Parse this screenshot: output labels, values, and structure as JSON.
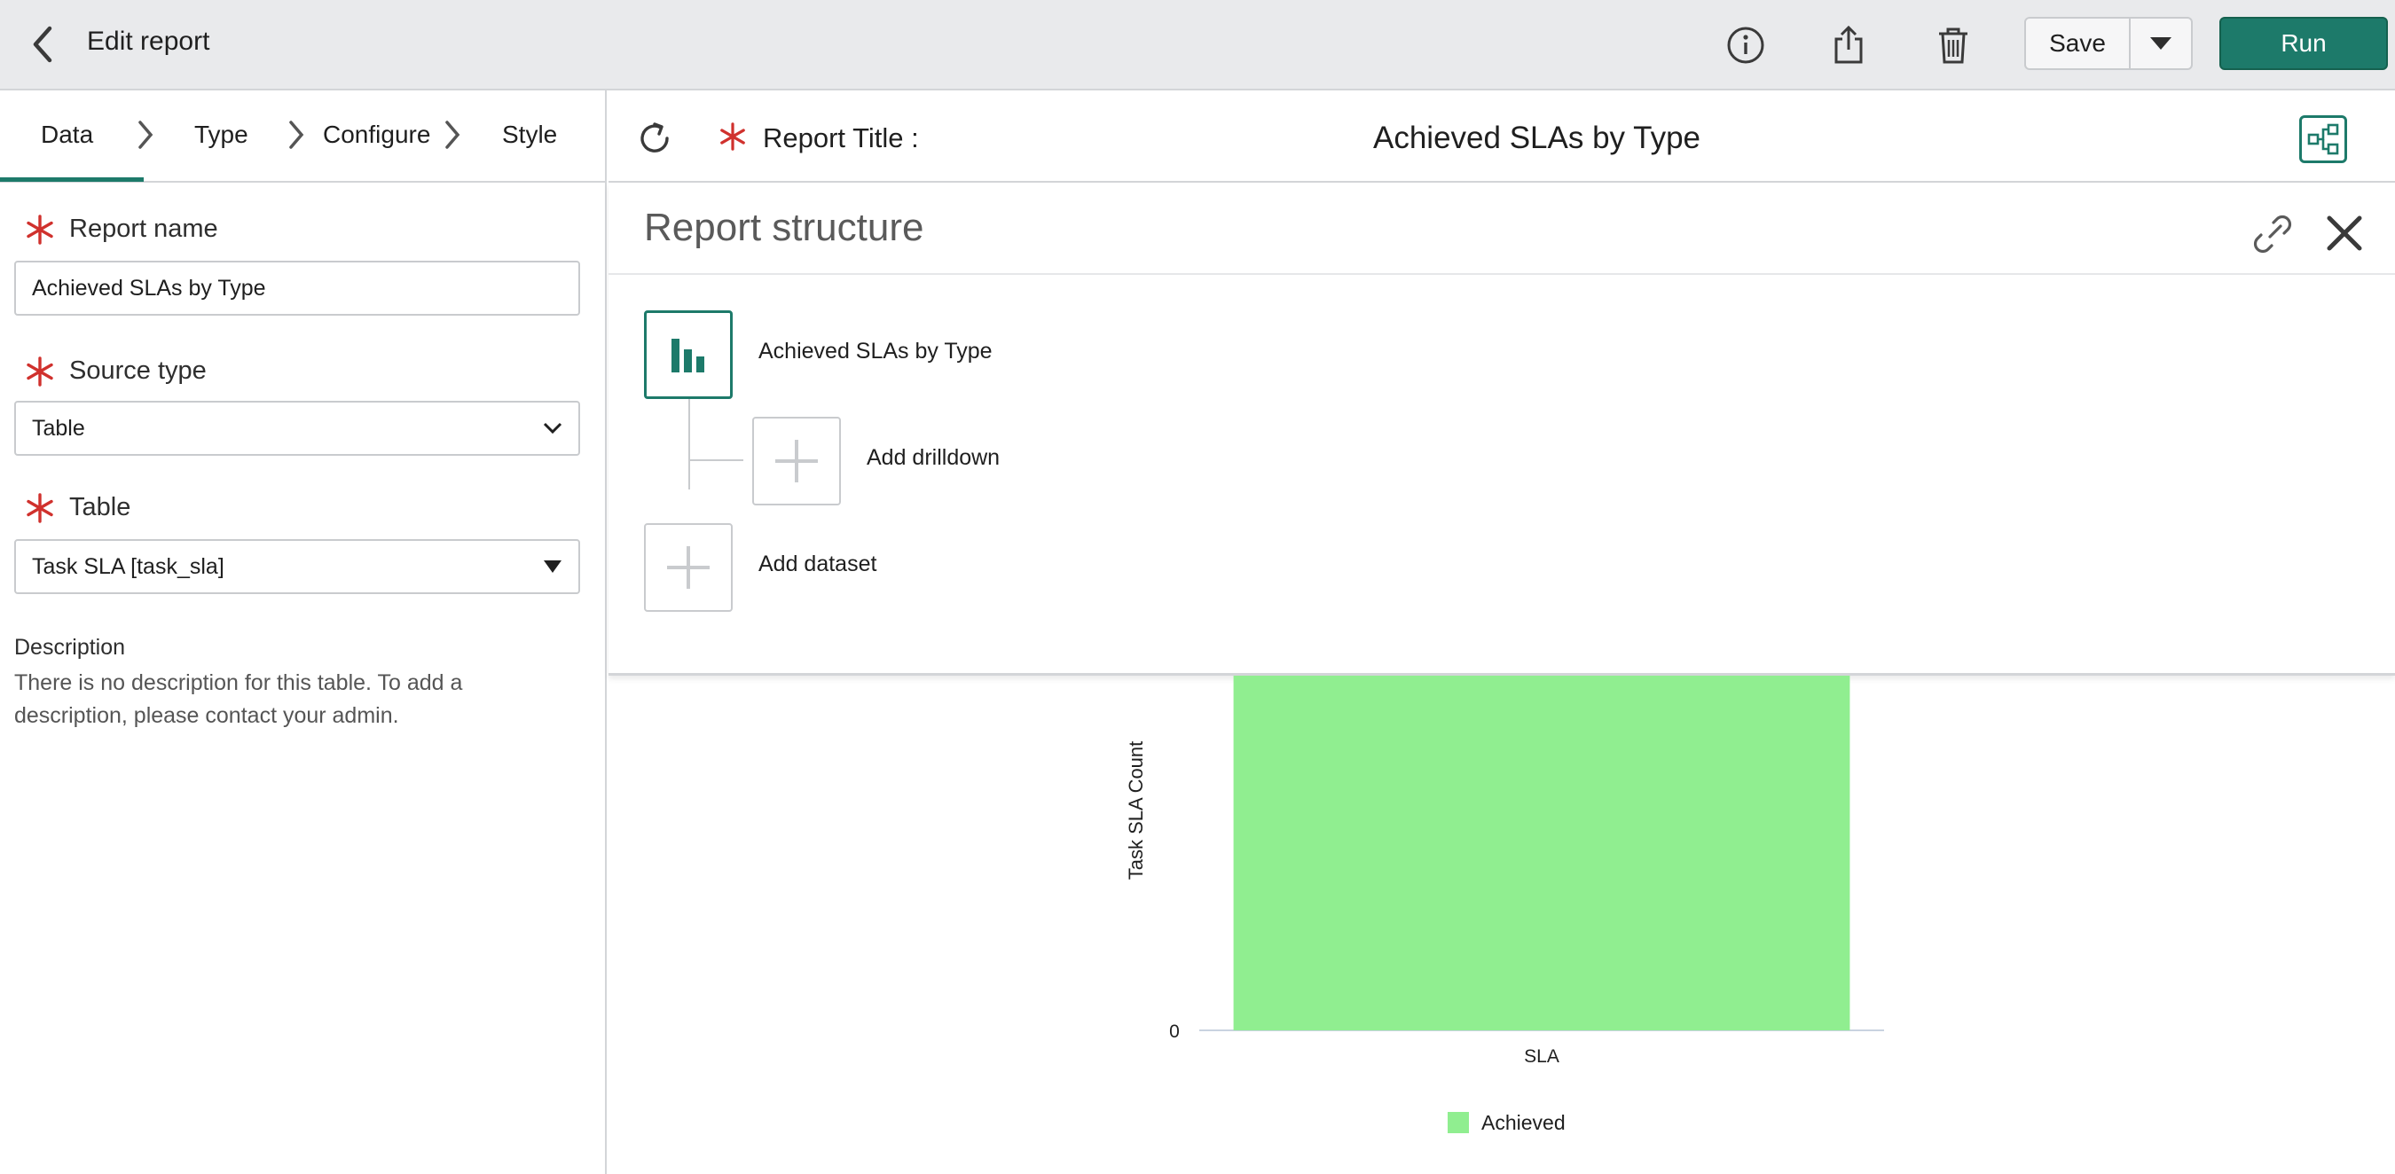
{
  "header": {
    "title": "Edit report",
    "save_label": "Save",
    "run_label": "Run",
    "icons": [
      "back-chevron-icon",
      "info-icon",
      "share-icon",
      "trash-icon",
      "caret-down-icon"
    ]
  },
  "tabs": [
    {
      "label": "Data",
      "active": true
    },
    {
      "label": "Type"
    },
    {
      "label": "Configure"
    },
    {
      "label": "Style"
    }
  ],
  "form": {
    "report_name": {
      "label": "Report name",
      "value": "Achieved SLAs by Type"
    },
    "source_type": {
      "label": "Source type",
      "value": "Table"
    },
    "table": {
      "label": "Table",
      "value": "Task SLA [task_sla]"
    },
    "description": {
      "label": "Description",
      "text": "There is no description for this table. To add a description, please contact your admin."
    }
  },
  "title_bar": {
    "label": "Report Title :",
    "value": "Achieved SLAs by Type"
  },
  "structure": {
    "title": "Report structure",
    "report_node": "Achieved SLAs by Type",
    "add_drilldown": "Add drilldown",
    "add_dataset": "Add dataset"
  },
  "colors": {
    "accent": "#1d7a6a",
    "required": "#d0312d",
    "bar": "#90ee90"
  },
  "chart_data": {
    "type": "bar",
    "categories": [
      "SLA"
    ],
    "series": [
      {
        "name": "Achieved",
        "values": [
          1
        ]
      }
    ],
    "xlabel": "",
    "ylabel": "Task SLA Count",
    "y_ticks": [
      "0"
    ],
    "legend": "bottom",
    "grid": false
  }
}
